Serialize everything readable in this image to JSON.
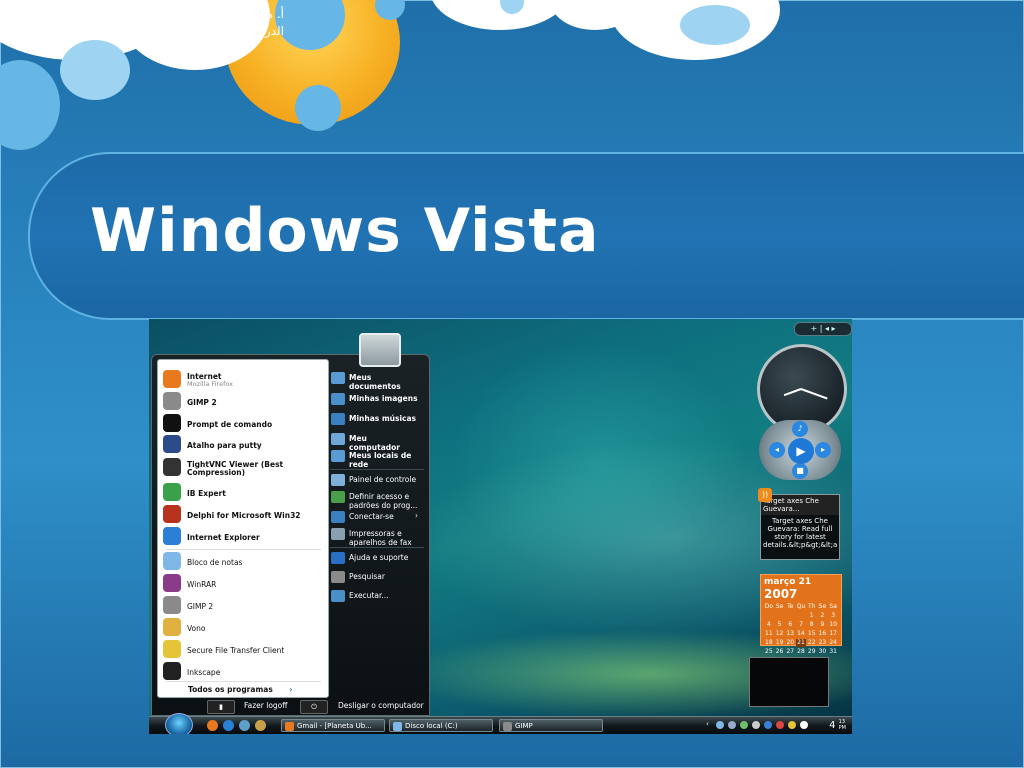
{
  "slide": {
    "caption_line1": "أ. مرام المغربي  تصميم واجهات المستخدم الفصل الدراسي",
    "caption_line2": "الثاني 1435",
    "title": "Windows Vista"
  },
  "start_menu": {
    "left_items": [
      {
        "title": "Internet",
        "subtitle": "Mozilla Firefox",
        "icon": "firefox-icon",
        "color": "#e8791f"
      },
      {
        "title": "GIMP 2",
        "icon": "gimp-icon",
        "color": "#8a8a8a"
      },
      {
        "title": "Prompt de comando",
        "icon": "command-prompt-icon",
        "color": "#111111"
      },
      {
        "title": "Atalho para putty",
        "icon": "putty-icon",
        "color": "#2b4b8a"
      },
      {
        "title": "TightVNC Viewer (Best",
        "subtitle": "Compression)",
        "icon": "vnc-icon",
        "color": "#333333"
      },
      {
        "title": "IB Expert",
        "icon": "ib-expert-icon",
        "color": "#3aa14a"
      },
      {
        "title": "Delphi for Microsoft Win32",
        "icon": "delphi-icon",
        "color": "#b8321e"
      },
      {
        "title": "Internet Explorer",
        "icon": "internet-explorer-icon",
        "color": "#2a7fd6"
      }
    ],
    "recent_items": [
      {
        "title": "Bloco de notas",
        "icon": "notepad-icon",
        "color": "#7fb7e6"
      },
      {
        "title": "WinRAR",
        "icon": "winrar-icon",
        "color": "#8a3b8a"
      },
      {
        "title": "GIMP 2",
        "icon": "gimp-icon",
        "color": "#8a8a8a"
      },
      {
        "title": "Vono",
        "icon": "vono-icon",
        "color": "#e0b040"
      },
      {
        "title": "Secure File Transfer Client",
        "icon": "sftp-icon",
        "color": "#e6c43a"
      },
      {
        "title": "Inkscape",
        "icon": "inkscape-icon",
        "color": "#222222"
      }
    ],
    "all_programs": "Todos os programas",
    "all_programs_arrow": "›",
    "right_items": [
      {
        "title": "Meus documentos",
        "icon": "documents-icon",
        "bold": true
      },
      {
        "title": "Minhas imagens",
        "icon": "pictures-icon",
        "bold": true
      },
      {
        "title": "Minhas músicas",
        "icon": "music-icon",
        "bold": true
      },
      {
        "title": "Meu computador",
        "icon": "computer-icon",
        "bold": true
      },
      {
        "title": "Meus locais de rede",
        "icon": "network-icon",
        "bold": true
      },
      {
        "title": "Painel de controle",
        "icon": "control-panel-icon",
        "bold": false
      },
      {
        "title": "Definir acesso e padrões do prog...",
        "icon": "default-programs-icon",
        "bold": false
      },
      {
        "title": "Conectar-se",
        "icon": "connect-icon",
        "bold": false,
        "arrow": "›"
      },
      {
        "title": "Impressoras e aparelhos de fax",
        "icon": "printers-icon",
        "bold": false
      },
      {
        "title": "Ajuda e suporte",
        "icon": "help-icon",
        "bold": false
      },
      {
        "title": "Pesquisar",
        "icon": "search-icon",
        "bold": false
      },
      {
        "title": "Executar...",
        "icon": "run-icon",
        "bold": false
      }
    ],
    "logoff": "Fazer logoff",
    "shutdown": "Desligar o computador"
  },
  "taskbar": {
    "tasks": [
      {
        "label": "Gmail - [Planeta Ub...",
        "icon": "firefox-icon",
        "color": "#e8791f"
      },
      {
        "label": "Disco local (C:)",
        "icon": "folder-icon",
        "color": "#7fb7e6"
      },
      {
        "label": "GIMP",
        "icon": "gimp-icon",
        "color": "#8a8a8a"
      }
    ],
    "tray_time": "4",
    "tray_time_small1": "13",
    "tray_time_small2": "PM"
  },
  "gadgets": {
    "sidebar_controls": "+ | ◂ ▸",
    "feed_title": "Target axes Che Guevara...",
    "feed_body": "Target axes Che Guevara: Read full story for latest details.&lt;p&gt;&lt;a",
    "calendar_month": "março",
    "calendar_day": "21",
    "calendar_year": "2007",
    "calendar_days": [
      "Do",
      "Se",
      "Te",
      "Qu",
      "Th",
      "Se",
      "Sa",
      "",
      "",
      "",
      "",
      "1",
      "2",
      "3",
      "4",
      "5",
      "6",
      "7",
      "8",
      "9",
      "10",
      "11",
      "12",
      "13",
      "14",
      "15",
      "16",
      "17",
      "18",
      "19",
      "20",
      "21",
      "22",
      "23",
      "24",
      "25",
      "26",
      "27",
      "28",
      "29",
      "30",
      "31"
    ]
  }
}
